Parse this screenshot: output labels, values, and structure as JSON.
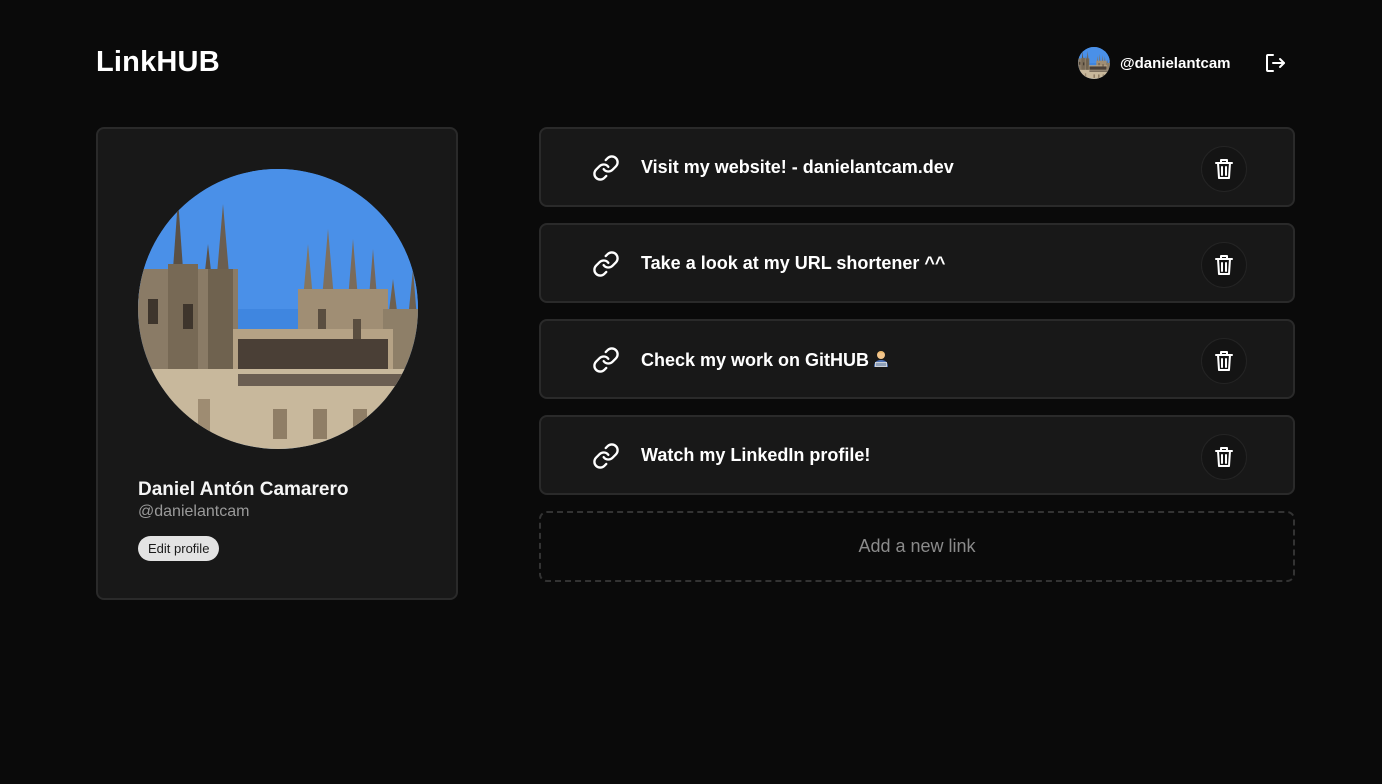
{
  "header": {
    "brand": "LinkHUB",
    "username": "@danielantcam",
    "avatar_icon": "profile-photo-cathedral",
    "logout_icon": "logout-icon"
  },
  "profile": {
    "name": "Daniel Antón Camarero",
    "handle": "@danielantcam",
    "edit_label": "Edit profile",
    "avatar_icon": "profile-photo-cathedral"
  },
  "links": [
    {
      "title": "Visit my website! - danielantcam.dev",
      "icon": "link-icon",
      "delete_icon": "trash-icon"
    },
    {
      "title": "Take a look at my URL shortener ^^",
      "icon": "link-icon",
      "delete_icon": "trash-icon"
    },
    {
      "title": "Check my work on GitHUB",
      "emoji": "technologist",
      "icon": "link-icon",
      "delete_icon": "trash-icon"
    },
    {
      "title": "Watch my LinkedIn profile!",
      "icon": "link-icon",
      "delete_icon": "trash-icon"
    }
  ],
  "add_link_label": "Add a new link",
  "colors": {
    "background": "#0a0a0a",
    "card": "#181818",
    "card_border": "#2a2a2a",
    "text": "#ffffff",
    "muted": "#9a9a9a"
  }
}
